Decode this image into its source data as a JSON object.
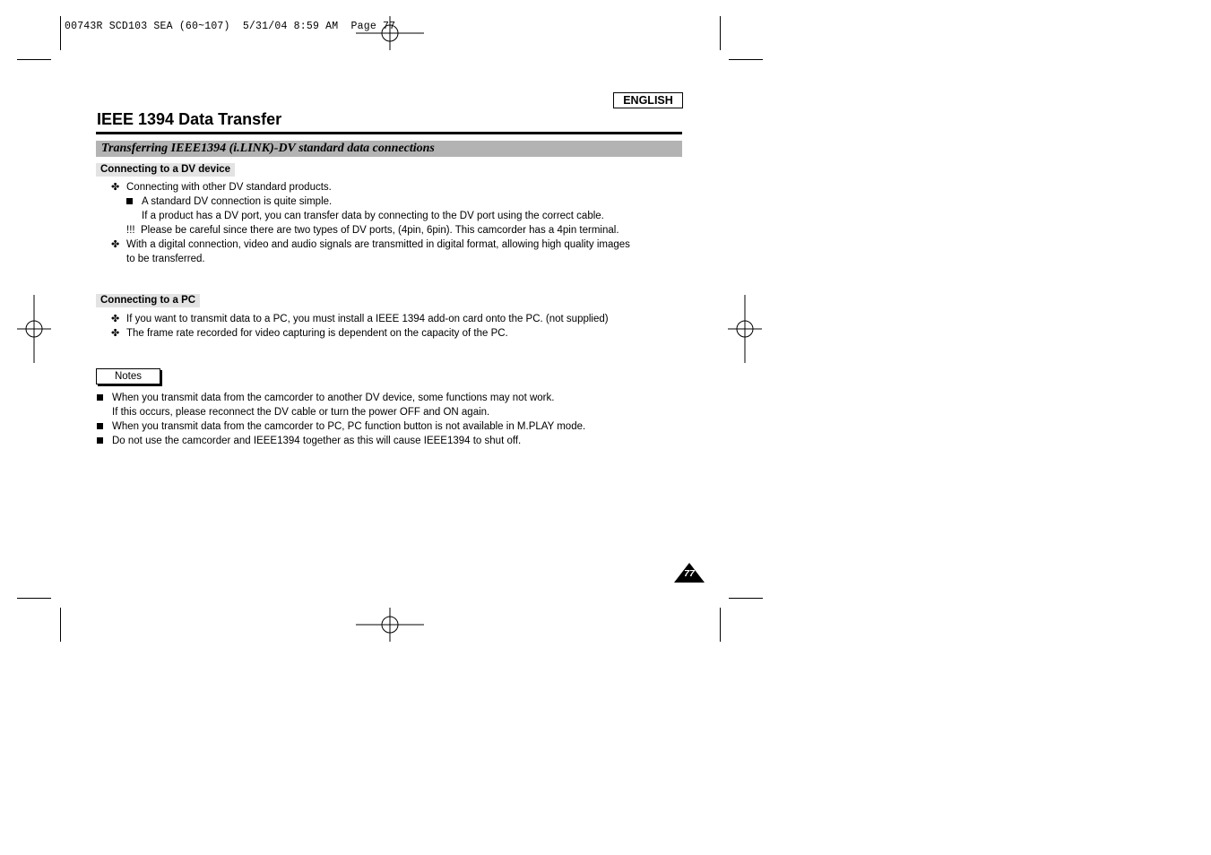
{
  "print_header": {
    "meta_text": "00743R SCD103 SEA (60~107)  5/31/04 8:59 AM  Page 77"
  },
  "language_badge": "ENGLISH",
  "page_title": "IEEE 1394 Data Transfer",
  "section_title": "Transferring IEEE1394 (i.LINK)-DV standard data connections",
  "dv_section": {
    "heading": "Connecting to a DV device",
    "lines": [
      {
        "marker": "✤",
        "text": "Connecting with other DV standard products."
      },
      {
        "marker": "■",
        "text": "A standard DV connection is quite simple."
      },
      {
        "marker": "",
        "text": "If a product has a DV port, you can transfer data by connecting to the DV port using the correct cable."
      },
      {
        "marker": "!!!",
        "text": "Please be careful since there are two types of DV ports, (4pin, 6pin). This camcorder has a 4pin terminal."
      },
      {
        "marker": "✤",
        "text": "With a digital connection, video and audio signals are transmitted in digital format, allowing high quality images"
      },
      {
        "marker": "",
        "text": "to be transferred."
      }
    ]
  },
  "pc_section": {
    "heading": "Connecting to a PC",
    "lines": [
      {
        "marker": "✤",
        "text": "If you want to transmit data to a PC, you must install a IEEE 1394 add-on card onto the PC. (not supplied)"
      },
      {
        "marker": "✤",
        "text": "The frame rate recorded for video capturing is dependent on the capacity of the PC."
      }
    ]
  },
  "notes": {
    "label": "Notes",
    "items": [
      {
        "marker": "■",
        "text": "When you transmit data from the camcorder to another DV device, some functions may not work."
      },
      {
        "marker": "",
        "text": "If this occurs, please reconnect the DV cable or turn the power OFF and ON again."
      },
      {
        "marker": "■",
        "text": "When you transmit data from the camcorder to PC, PC function button is not available in M.PLAY mode."
      },
      {
        "marker": "■",
        "text": "Do not use the camcorder and IEEE1394 together as this will cause IEEE1394 to shut off."
      }
    ]
  },
  "page_number": "77"
}
